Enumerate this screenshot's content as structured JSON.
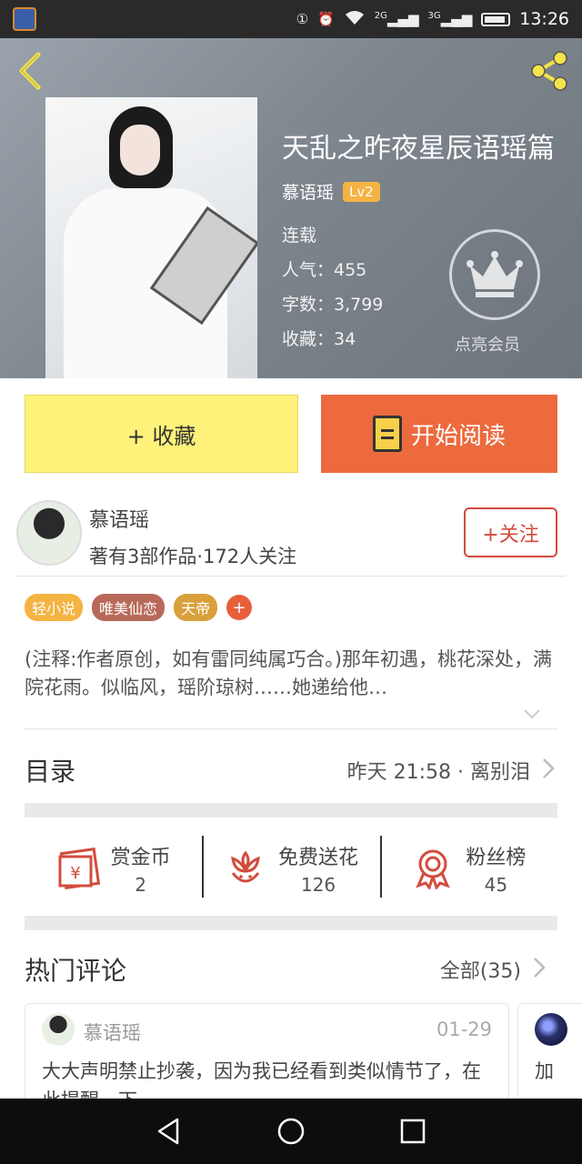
{
  "status_bar": {
    "time": "13:26",
    "net1": "2G",
    "net2": "3G"
  },
  "book": {
    "title": "天乱之昨夜星辰语瑶篇",
    "author": "慕语瑶",
    "level": "Lv2",
    "status": "连载",
    "popularity": "人气：455",
    "word_count": "字数：3,799",
    "favorites": "收藏：34",
    "vip_label": "点亮会员"
  },
  "actions": {
    "collect": "+ 收藏",
    "read": "开始阅读"
  },
  "author_panel": {
    "name": "慕语瑶",
    "meta": "著有3部作品·172人关注",
    "follow": "+关注"
  },
  "tags": [
    {
      "label": "轻小说",
      "color": "#f4b342"
    },
    {
      "label": "唯美仙恋",
      "color": "#b86a5a"
    },
    {
      "label": "天帝",
      "color": "#d9a03c"
    }
  ],
  "tag_add": "+",
  "description": "(注释:作者原创，如有雷同纯属巧合。)那年初遇，桃花深处，满院花雨。似临风，瑶阶琼树……她递给他…",
  "toc": {
    "title": "目录",
    "latest": "昨天 21:58 · 离别泪"
  },
  "stats": [
    {
      "label": "赏金币",
      "value": "2"
    },
    {
      "label": "免费送花",
      "value": "126"
    },
    {
      "label": "粉丝榜",
      "value": "45"
    }
  ],
  "comments_header": {
    "title": "热门评论",
    "all": "全部(35)"
  },
  "comments": [
    {
      "name": "慕语瑶",
      "date": "01-29",
      "text": "大大声明禁止抄袭，因为我已经看到类似情节了，在此提醒一下"
    },
    {
      "text": "加"
    }
  ],
  "colors": {
    "accent": "#ec6a3d",
    "collect_bg": "#fef27a",
    "follow": "#d24c3d",
    "level_badge": "#f4b342"
  }
}
